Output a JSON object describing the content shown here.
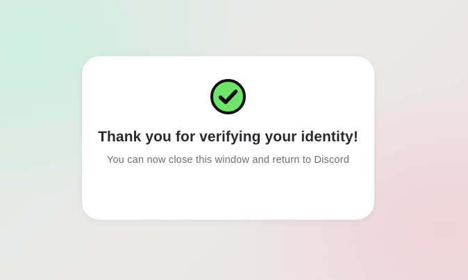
{
  "dialog": {
    "icon": "check-circle-icon",
    "icon_color": "#6fe36a",
    "title": "Thank you for verifying your identity!",
    "message": "You can now close this window and return to Discord"
  },
  "colors": {
    "card_background": "#ffffff",
    "title_text": "#2a2a2e",
    "message_text": "#6e6f75"
  }
}
